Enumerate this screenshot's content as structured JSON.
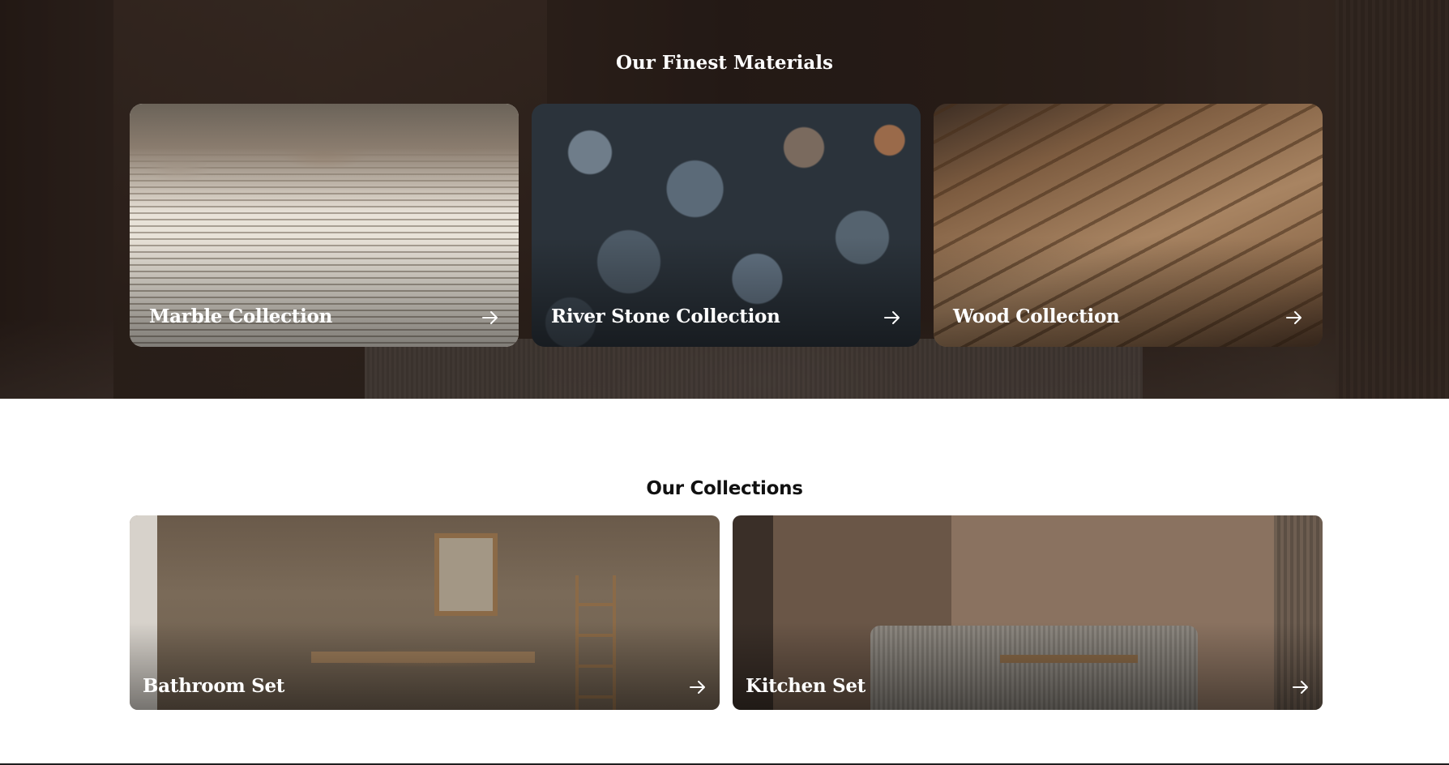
{
  "materials": {
    "title": "Our Finest Materials",
    "cards": [
      {
        "label": "Marble Collection",
        "icon": "arrow-right-icon"
      },
      {
        "label": "River Stone Collection",
        "icon": "arrow-right-icon"
      },
      {
        "label": "Wood Collection",
        "icon": "arrow-right-icon"
      }
    ]
  },
  "collections": {
    "title": "Our Collections",
    "cards": [
      {
        "label": "Bathroom Set",
        "icon": "arrow-right-icon"
      },
      {
        "label": "Kitchen Set",
        "icon": "arrow-right-icon"
      }
    ]
  },
  "colors": {
    "hero_background": "#2a1f19",
    "card_text": "#ffffff",
    "heading_dark": "#111111"
  }
}
